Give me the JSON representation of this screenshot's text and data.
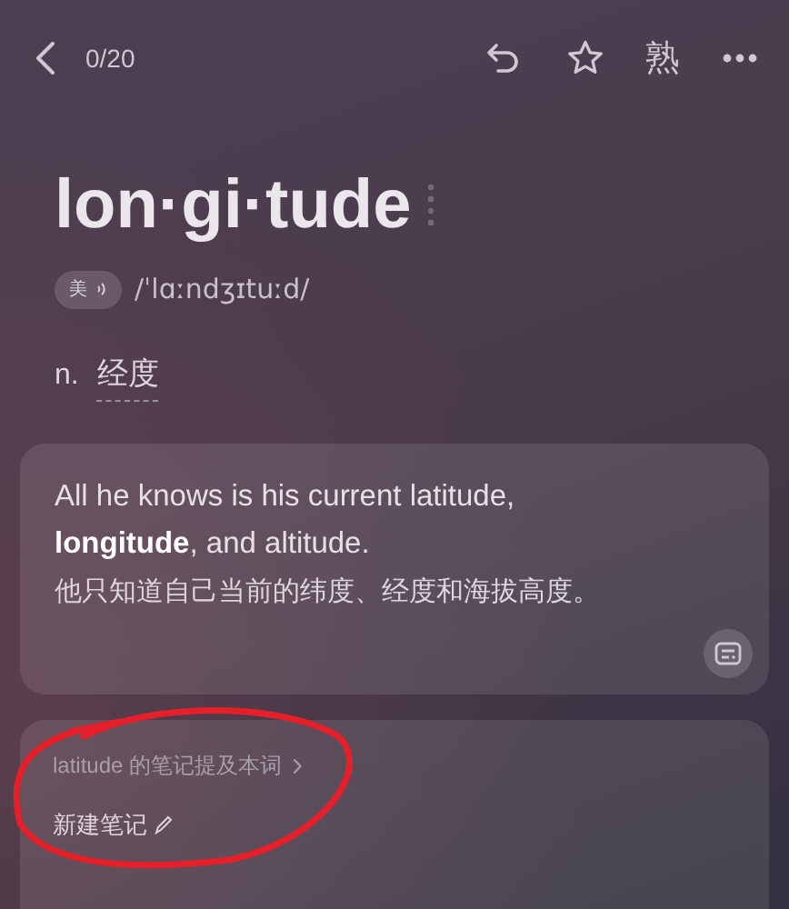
{
  "top_bar": {
    "progress": "0/20",
    "known_button": "熟"
  },
  "word": {
    "headword": "lon·gi·tude",
    "accent": "美",
    "phonetic": "/ˈlɑːndʒɪtuːd/",
    "part_of_speech": "n.",
    "meaning": "经度"
  },
  "example": {
    "sentence": "All he knows is his current latitude, **longitude**, and altitude.",
    "translation": "他只知道自己当前的纬度、经度和海拔高度。"
  },
  "notes": {
    "mention_link": "latitude 的笔记提及本词",
    "new_note": "新建笔记"
  }
}
